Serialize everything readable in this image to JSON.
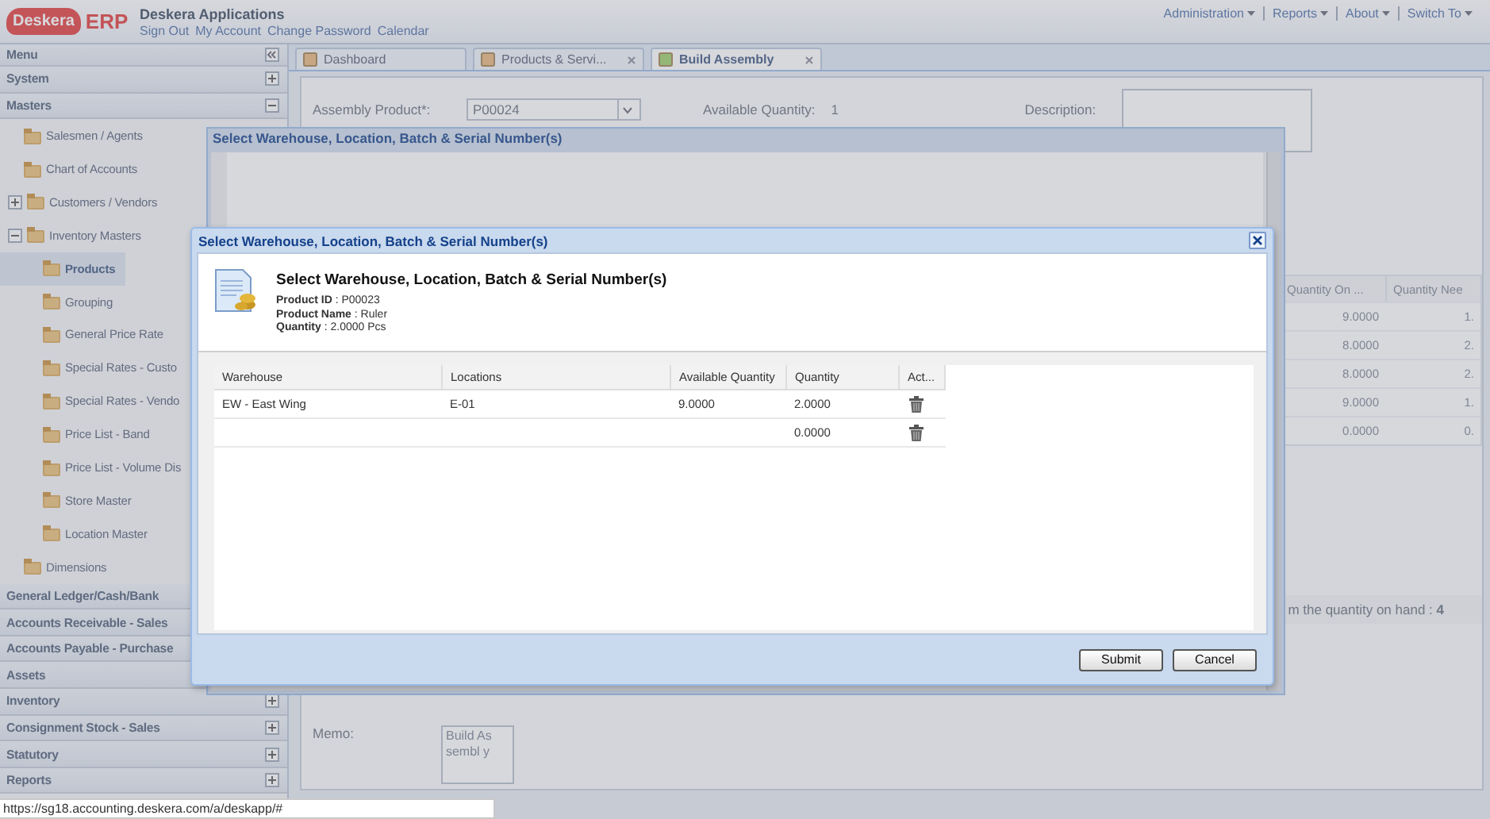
{
  "header": {
    "logo": "Deskera",
    "logo_suffix": "ERP",
    "app_title": "Deskera Applications",
    "links": [
      "Sign Out",
      "My Account",
      "Change Password",
      "Calendar"
    ],
    "menus": [
      "Administration",
      "Reports",
      "About",
      "Switch To"
    ]
  },
  "sidebar": {
    "title": "Menu",
    "sections": [
      {
        "label": "System",
        "expanded": false
      },
      {
        "label": "Masters",
        "expanded": true,
        "children": [
          {
            "label": "Salesmen / Agents",
            "selected": false
          },
          {
            "label": "Chart of Accounts",
            "selected": false
          },
          {
            "label": "Customers / Vendors",
            "selected": false,
            "expanded": false
          },
          {
            "label": "Inventory Masters",
            "selected": false,
            "expanded": true,
            "children": [
              {
                "label": "Products",
                "selected": true
              },
              {
                "label": "Grouping",
                "selected": false
              },
              {
                "label": "General Price Rate",
                "selected": false
              },
              {
                "label": "Special Rates - Custo",
                "selected": false
              },
              {
                "label": "Special Rates - Vendo",
                "selected": false
              },
              {
                "label": "Price List - Band",
                "selected": false
              },
              {
                "label": "Price List - Volume Dis",
                "selected": false
              },
              {
                "label": "Store Master",
                "selected": false
              },
              {
                "label": "Location Master",
                "selected": false
              }
            ]
          },
          {
            "label": "Dimensions",
            "selected": false
          }
        ]
      },
      {
        "label": "General Ledger/Cash/Bank"
      },
      {
        "label": "Accounts Receivable - Sales"
      },
      {
        "label": "Accounts Payable - Purchase"
      },
      {
        "label": "Assets"
      },
      {
        "label": "Inventory",
        "expanded": false
      },
      {
        "label": "Consignment Stock - Sales",
        "expanded": false
      },
      {
        "label": "Statutory",
        "expanded": false
      },
      {
        "label": "Reports",
        "expanded": false
      }
    ]
  },
  "main": {
    "tabs": [
      {
        "label": "Dashboard",
        "selected": false,
        "closable": false
      },
      {
        "label": "Products & Servi...",
        "selected": false,
        "closable": true
      },
      {
        "label": "Build Assembly",
        "selected": true,
        "closable": true
      }
    ],
    "form": {
      "assembly_product": {
        "label": "Assembly Product*:",
        "value": "P00024"
      },
      "available_quantity": {
        "label": "Available Quantity:",
        "value": "1"
      },
      "description": {
        "label": "Description:"
      }
    },
    "grid": {
      "columns": [
        "Quantity On ...",
        "Quantity Nee"
      ],
      "rows": [
        [
          "9.0000",
          "1."
        ],
        [
          "8.0000",
          "2."
        ],
        [
          "8.0000",
          "2."
        ],
        [
          "9.0000",
          "1."
        ],
        [
          "0.0000",
          "0."
        ]
      ]
    },
    "note": "m the quantity on hand : **4**",
    "memo": {
      "label": "Memo:",
      "value": "Build Assembl y"
    }
  },
  "back_dialog": {
    "title": "Select Warehouse, Location, Batch & Serial Number(s)"
  },
  "dialog": {
    "title": "Select Warehouse, Location, Batch & Serial Number(s)",
    "heading": "Select Warehouse, Location, Batch & Serial Number(s)",
    "details": [
      "**Product ID** : P00023",
      "**Product Name** : Ruler",
      "**Quantity** : 2.0000 Pcs"
    ],
    "columns": [
      "Warehouse",
      "Locations",
      "Available Quantity",
      "Quantity",
      "Act..."
    ],
    "rows": [
      {
        "warehouse": "EW - East Wing",
        "location": "E-01",
        "available": "9.0000",
        "quantity": "2.0000"
      },
      {
        "quantity": "0.0000"
      }
    ],
    "buttons": [
      "Submit",
      "Cancel"
    ]
  },
  "status_url": "https://sg18.accounting.deskera.com/a/deskapp/#"
}
